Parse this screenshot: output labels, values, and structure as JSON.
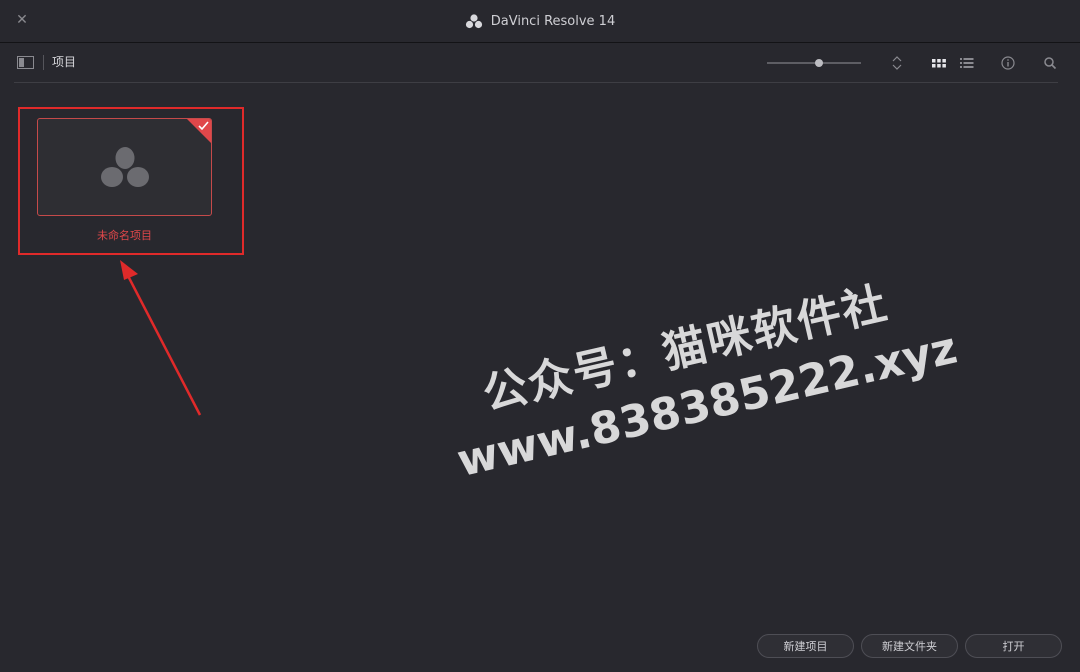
{
  "window": {
    "title": "DaVinci Resolve 14",
    "close_symbol": "✕"
  },
  "toolbar": {
    "breadcrumb": "项目",
    "zoom_level": 0.55,
    "icons": [
      "panel-toggle-icon",
      "sort-icon",
      "grid-view-icon",
      "list-view-icon",
      "info-icon",
      "search-icon"
    ]
  },
  "projects": [
    {
      "name": "未命名项目",
      "selected": true
    }
  ],
  "watermark": {
    "line1": "公众号：猫咪软件社",
    "line2": "www.838385222.xyz"
  },
  "buttons": {
    "new_project": "新建项目",
    "new_folder": "新建文件夹",
    "open": "打开"
  },
  "colors": {
    "background": "#28282e",
    "highlight": "#e02a2a",
    "selected_text": "#e0474a"
  }
}
